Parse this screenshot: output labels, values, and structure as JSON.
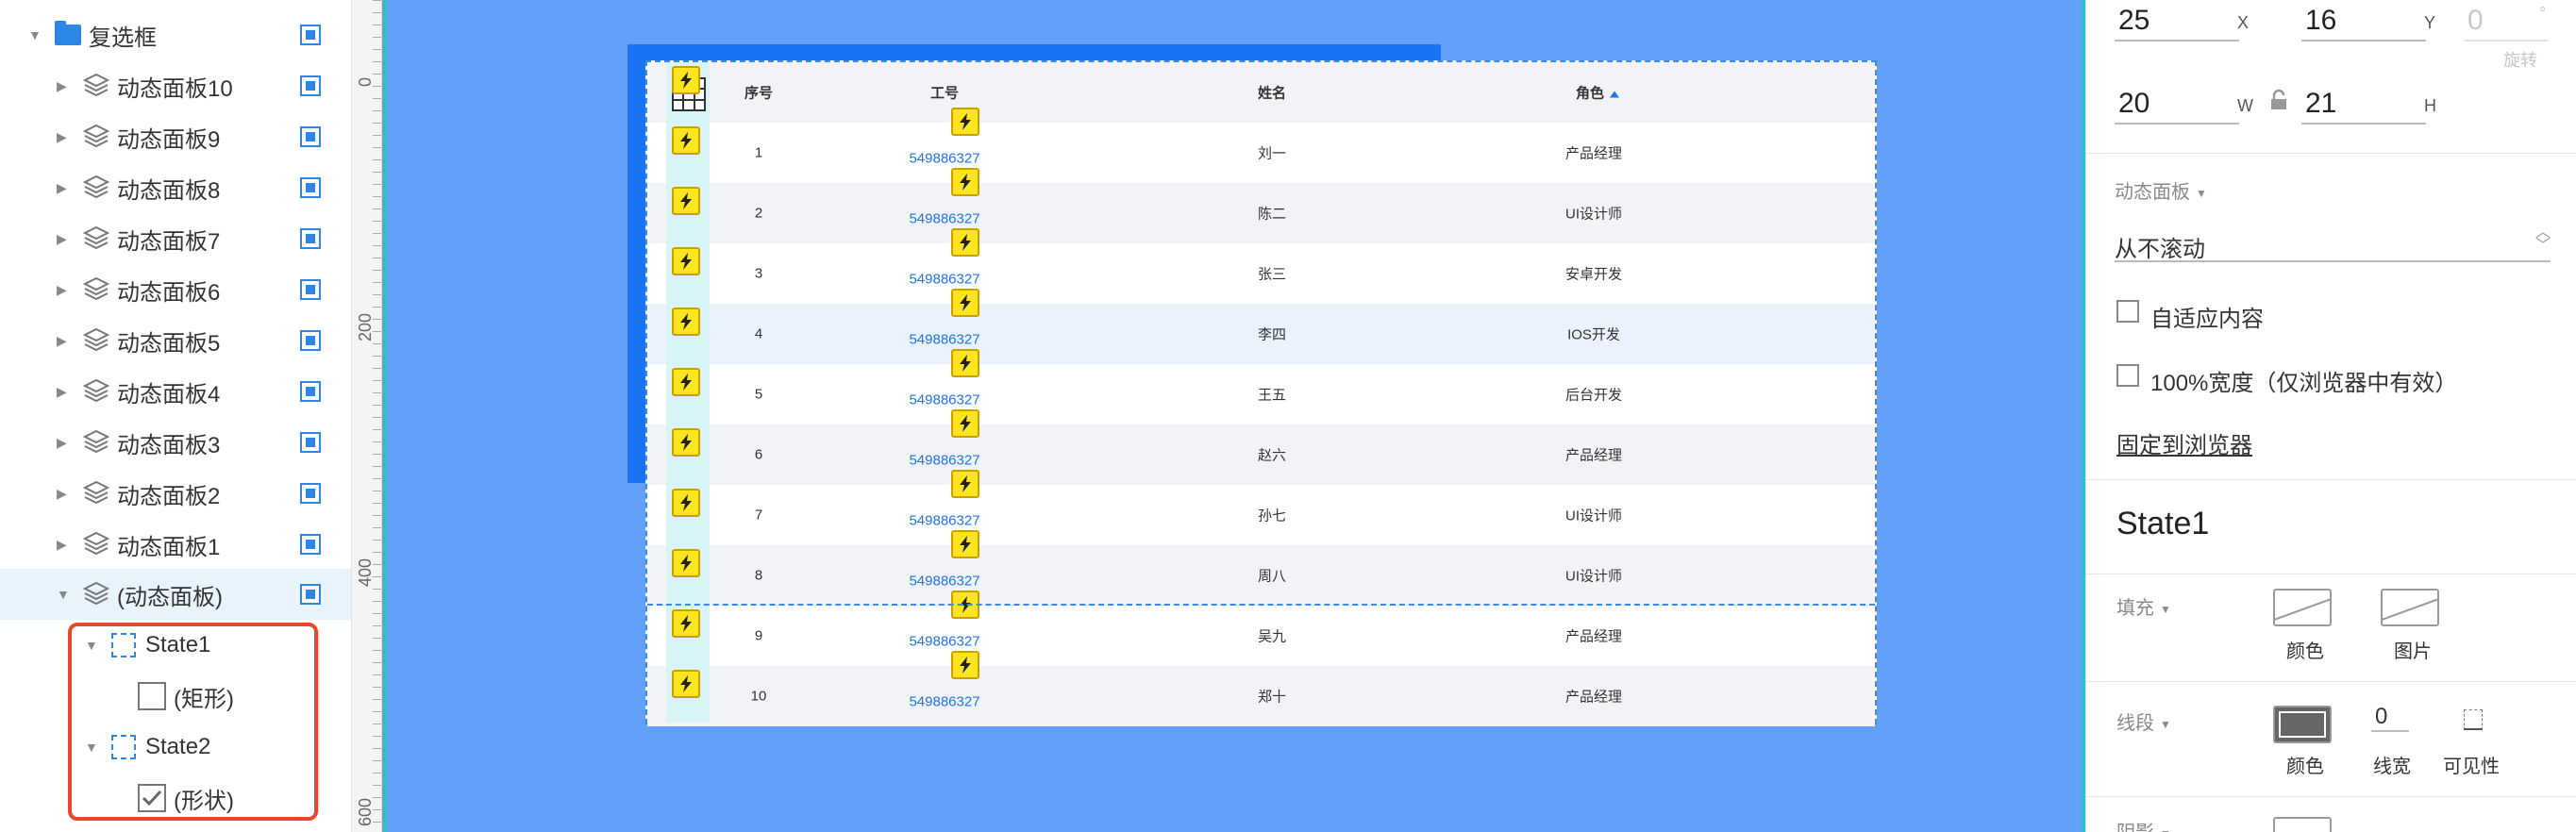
{
  "layers_panel": {
    "root": {
      "label": "复选框"
    },
    "panels": [
      {
        "label": "动态面板10"
      },
      {
        "label": "动态面板9"
      },
      {
        "label": "动态面板8"
      },
      {
        "label": "动态面板7"
      },
      {
        "label": "动态面板6"
      },
      {
        "label": "动态面板5"
      },
      {
        "label": "动态面板4"
      },
      {
        "label": "动态面板3"
      },
      {
        "label": "动态面板2"
      },
      {
        "label": "动态面板1"
      }
    ],
    "selected_panel": {
      "label": "(动态面板)"
    },
    "states": [
      {
        "label": "State1",
        "child_label": "(矩形)"
      },
      {
        "label": "State2",
        "child_label": "(形状)"
      }
    ]
  },
  "ruler": {
    "labels": [
      "0",
      "200",
      "400",
      "600"
    ]
  },
  "table": {
    "headers": {
      "index": "序号",
      "id": "工号",
      "name": "姓名",
      "role": "角色"
    },
    "rows": [
      {
        "index": "1",
        "id": "549886327",
        "name": "刘一",
        "role": "产品经理"
      },
      {
        "index": "2",
        "id": "549886327",
        "name": "陈二",
        "role": "UI设计师"
      },
      {
        "index": "3",
        "id": "549886327",
        "name": "张三",
        "role": "安卓开发"
      },
      {
        "index": "4",
        "id": "549886327",
        "name": "李四",
        "role": "IOS开发"
      },
      {
        "index": "5",
        "id": "549886327",
        "name": "王五",
        "role": "后台开发"
      },
      {
        "index": "6",
        "id": "549886327",
        "name": "赵六",
        "role": "产品经理"
      },
      {
        "index": "7",
        "id": "549886327",
        "name": "孙七",
        "role": "UI设计师"
      },
      {
        "index": "8",
        "id": "549886327",
        "name": "周八",
        "role": "UI设计师"
      },
      {
        "index": "9",
        "id": "549886327",
        "name": "吴九",
        "role": "产品经理"
      },
      {
        "index": "10",
        "id": "549886327",
        "name": "郑十",
        "role": "产品经理"
      }
    ]
  },
  "inspector": {
    "x": {
      "value": "25",
      "unit": "X"
    },
    "y": {
      "value": "16",
      "unit": "Y"
    },
    "rotation": {
      "value": "0",
      "unit": "°",
      "caption": "旋转"
    },
    "w": {
      "value": "20",
      "unit": "W"
    },
    "h": {
      "value": "21",
      "unit": "H"
    },
    "panel_section": {
      "title": "动态面板",
      "scroll_value": "从不滚动"
    },
    "fit_content": "自适应内容",
    "full_width": "100%宽度（仅浏览器中有效）",
    "pin_to_browser": "固定到浏览器",
    "state_name": "State1",
    "fill": {
      "title": "填充",
      "color_label": "颜色",
      "image_label": "图片"
    },
    "border": {
      "title": "线段",
      "color_label": "颜色",
      "width_value": "0",
      "width_label": "线宽",
      "visibility_label": "可见性"
    },
    "shadow": {
      "title": "阴影"
    }
  },
  "colors": {
    "canvas": "#62a0fa",
    "accent": "#1c75f0",
    "highlight": "#e9462d",
    "bolt": "#ffe51f"
  }
}
